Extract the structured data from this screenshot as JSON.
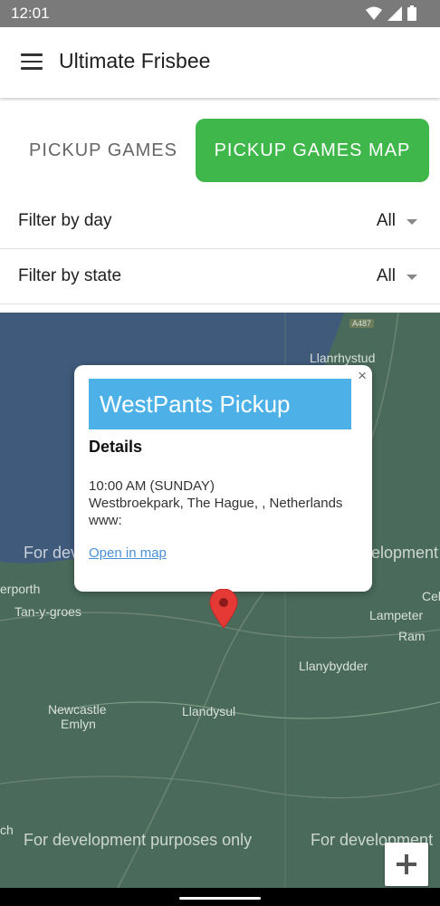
{
  "status": {
    "time": "12:01"
  },
  "appbar": {
    "title": "Ultimate Frisbee"
  },
  "tabs": [
    {
      "label": "PICKUP GAMES",
      "selected": false
    },
    {
      "label": "PICKUP GAMES MAP",
      "selected": true
    }
  ],
  "filters": [
    {
      "label": "Filter by day",
      "value": "All"
    },
    {
      "label": "Filter by state",
      "value": "All"
    }
  ],
  "map": {
    "place_labels": [
      "Llanrhystud",
      "erporth",
      "Tan-y-groes",
      "Newcastle",
      "Emlyn",
      "Llandysul",
      "Lampeter",
      "Cel",
      "Ram",
      "Llanybydder",
      "ch"
    ],
    "watermarks": [
      "For dev",
      "elopment",
      "For development purposes only",
      "For development"
    ],
    "road_badge": "A487"
  },
  "popup": {
    "title": "WestPants Pickup",
    "section": "Details",
    "time": "10:00 AM (SUNDAY)",
    "address": "Westbroekpark, The Hague, , Netherlands",
    "website": "www:",
    "link": "Open in map",
    "close": "×"
  },
  "colors": {
    "accent_green": "#3fb74b",
    "popup_header": "#4db1e8",
    "map_land": "#4a6b5b",
    "map_sea": "#3f5a7a"
  }
}
